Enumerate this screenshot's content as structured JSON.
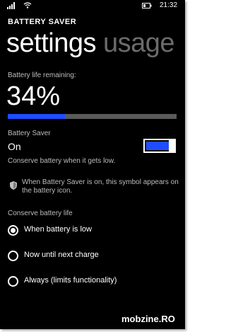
{
  "status_bar": {
    "time": "21:32",
    "icons": [
      "signal-icon",
      "wifi-icon",
      "battery-icon"
    ]
  },
  "app_title": "BATTERY SAVER",
  "pivot": {
    "tabs": [
      {
        "label": "settings",
        "active": true
      },
      {
        "label": "usage",
        "active": false
      }
    ]
  },
  "battery": {
    "remaining_label": "Battery life remaining:",
    "percent_text": "34%",
    "level": 0.34
  },
  "saver": {
    "label": "Battery Saver",
    "state_text": "On",
    "enabled": true,
    "description": "Conserve battery when it gets low.",
    "note": "When Battery Saver is on, this symbol appears on the battery icon."
  },
  "conserve": {
    "label": "Conserve battery life",
    "options": [
      {
        "label": "When battery is low",
        "selected": true
      },
      {
        "label": "Now until next charge",
        "selected": false
      },
      {
        "label": "Always (limits functionality)",
        "selected": false
      }
    ]
  },
  "watermark": "mobzine.RO",
  "colors": {
    "background": "#000000",
    "accent": "#1f4cff",
    "text": "#ffffff",
    "subtext": "#bdbdbd",
    "inactive": "#6b6b6b"
  }
}
